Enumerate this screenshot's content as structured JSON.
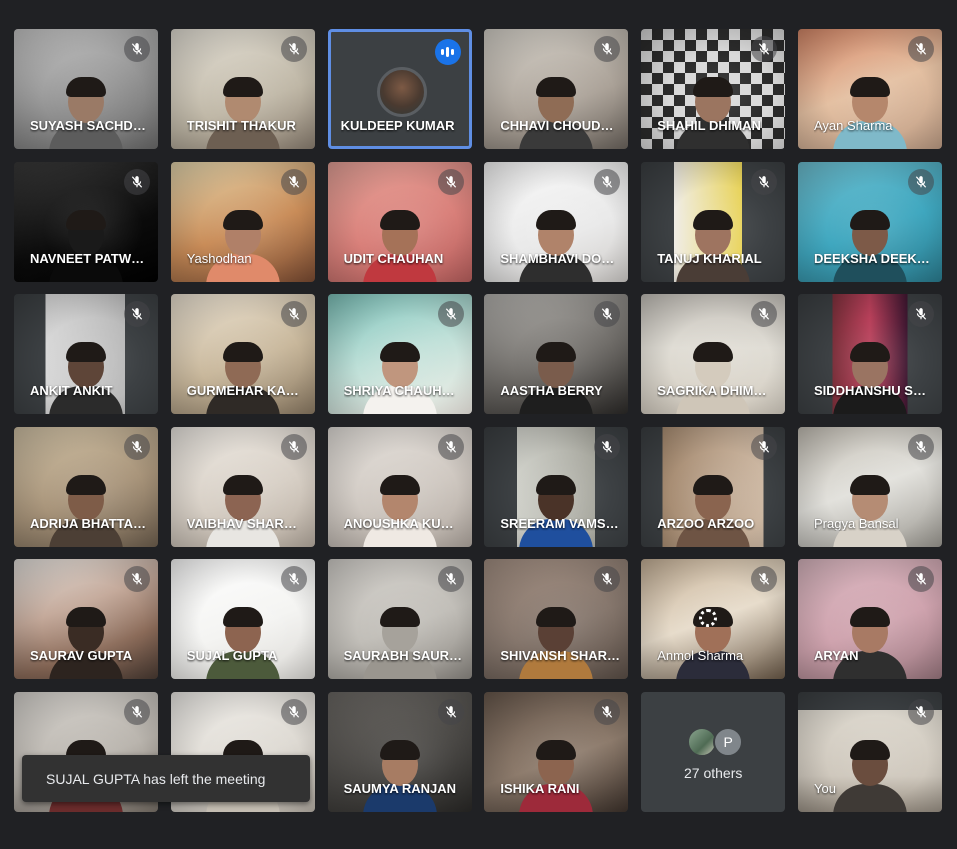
{
  "tiles": [
    {
      "name": "SUYASH SACHD…",
      "bg": "linear-gradient(160deg,#c9c9c9,#8d8d8d 60%,#6b6b6b)",
      "skin": "#9a7a66",
      "shirt": "#5c5c5c",
      "muted": true
    },
    {
      "name": "TRISHIT THAKUR",
      "bg": "linear-gradient(160deg,#e6e2d8,#bfb7a6 60%,#8c8072)",
      "skin": "#b08a70",
      "shirt": "#6d5f52",
      "muted": true
    },
    {
      "name": "KULDEEP KUMAR",
      "speaking": true
    },
    {
      "name": "CHHAVI CHOUD…",
      "bg": "linear-gradient(160deg,#d8d4cc,#aaa197 60%,#6c655e)",
      "skin": "#8f6c55",
      "shirt": "#3a3a3a",
      "muted": true
    },
    {
      "name": "SHAHIL DHIMAN",
      "bg": "repeating-conic-gradient(#2b2b2b 0% 25%,#d9d9d9 0% 50%) 0 0/22px 22px",
      "skin": "#9b7560",
      "shirt": "#2f2f2f",
      "muted": true
    },
    {
      "name": "Ayan Sharma",
      "bg": "linear-gradient(160deg,#d98a6a,#e4c0a2 50%,#bf9e86)",
      "skin": "#b5876c",
      "shirt": "#7fb9c9",
      "muted": true,
      "mixed": true
    },
    {
      "name": "NAVNEET PATW…",
      "bg": "linear-gradient(160deg,#3a3a3a,#0b0b0b 60%,#000)",
      "skin": "#1a1a1a",
      "shirt": "#0a0a0a",
      "muted": true
    },
    {
      "name": "Yashodhan",
      "bg": "linear-gradient(160deg,#e8d9b0,#c98c58 55%,#7a4b32)",
      "skin": "#b08068",
      "shirt": "#e08a6a",
      "muted": true,
      "mixed": true
    },
    {
      "name": "UDIT CHAUHAN",
      "bg": "linear-gradient(160deg,#e8a49a,#d9807a 55%,#b9605e)",
      "skin": "#a57258",
      "shirt": "#c0393f",
      "muted": true
    },
    {
      "name": "SHAMBHAVI DO…",
      "bg": "linear-gradient(160deg,#fafafa,#e9e9e9 60%,#d0cdca)",
      "skin": "#b0836a",
      "shirt": "#2e2e2e",
      "muted": true
    },
    {
      "name": "TANUJ KHARIAL",
      "bg": "linear-gradient(90deg,#3c4043 0%,#3c4043 23%,#f0ede6 23%,#e8d35a 70%,#3c4043 70%)",
      "skin": "#9e7460",
      "shirt": "#4a3d36",
      "muted": true
    },
    {
      "name": "DEEKSHA DEEK…",
      "bg": "linear-gradient(160deg,#6fc1d3,#3fa7bf 55%,#2b7d90)",
      "skin": "#7d5a48",
      "shirt": "#1f4f5c",
      "muted": true
    },
    {
      "name": "ANKIT ANKIT",
      "bg": "linear-gradient(90deg,#3c4043 0%,#3c4043 22%,#d8d8d8 22%,#b9b9b9 77%,#3c4043 77%)",
      "skin": "#5e4538",
      "shirt": "#2b2b2b",
      "muted": true
    },
    {
      "name": "GURMEHAR KA…",
      "bg": "linear-gradient(160deg,#efe6d6,#c8b79b 55%,#8c7b64)",
      "skin": "#8f6a55",
      "shirt": "#2f2a26",
      "muted": true
    },
    {
      "name": "SHRIYA CHAUH…",
      "bg": "linear-gradient(160deg,#7fc5bd,#bfe0d8 50%,#f3efe8)",
      "skin": "#c0967e",
      "shirt": "#f4f2ee",
      "muted": true
    },
    {
      "name": "AASTHA BERRY",
      "bg": "linear-gradient(160deg,#b8b6b2,#6f6c68 55%,#2c2a28)",
      "skin": "#7a5c4c",
      "shirt": "#1e1e1e",
      "muted": true
    },
    {
      "name": "SAGRIKA DHIM…",
      "bg": "linear-gradient(180deg,#c9c5be,#e0ddd5 45%,#d6cfc3)",
      "skin": "#d4cbbd",
      "shirt": "#cfc6b8",
      "muted": true
    },
    {
      "name": "SIDDHANSHU S…",
      "bg": "linear-gradient(90deg,#3c4043 0%,#3c4043 24%,#7a2f3a 24%,#b8405a 50%,#3d1630 76%,#3c4043 76%)",
      "skin": "#9a7462",
      "shirt": "#1b1b1b",
      "muted": true
    },
    {
      "name": "ADRIJA BHATTA…",
      "bg": "linear-gradient(160deg,#d3c4a8,#a8947a 55%,#6f604f)",
      "skin": "#7e5c48",
      "shirt": "#4c3f35",
      "muted": true
    },
    {
      "name": "VAIBHAV SHAR…",
      "bg": "linear-gradient(160deg,#f0ece6,#d7cfc5 55%,#b8ada1)",
      "skin": "#8c6452",
      "shirt": "#e8e6e2",
      "muted": true
    },
    {
      "name": "ANOUSHKA KU…",
      "bg": "linear-gradient(160deg,#e8e4df,#cfc8c1 55%,#b3aaa2)",
      "skin": "#b3866d",
      "shirt": "#efe9e3",
      "muted": true
    },
    {
      "name": "SREERAM VAMS…",
      "bg": "linear-gradient(90deg,#3c4043 0%,#3c4043 23%,#cfd0c9 23%,#a7a79e 77%,#3c4043 77%)",
      "skin": "#4a3328",
      "shirt": "#1f4f9e",
      "muted": true
    },
    {
      "name": "ARZOO ARZOO",
      "bg": "linear-gradient(90deg,#3c4043 0%,#3c4043 15%,#a58a70 15%,#cdb8a3 85%,#3c4043 85%)",
      "skin": "#8a644f",
      "shirt": "#6e5444",
      "muted": true
    },
    {
      "name": "Pragya Bansal",
      "bg": "linear-gradient(160deg,#c7c2b8,#e2e1dc 50%,#9d9a93)",
      "skin": "#b58c74",
      "shirt": "#d8d2c8",
      "muted": true,
      "mixed": true
    },
    {
      "name": "SAURAV GUPTA",
      "bg": "linear-gradient(160deg,#e8e5e1,#c4a99a 40%,#8a6a58 70%,#4a3b33)",
      "skin": "#3a2c24",
      "shirt": "#2d241f",
      "muted": true
    },
    {
      "name": "SUJAL GUPTA",
      "bg": "linear-gradient(160deg,#ffffff,#f4f4f2 55%,#dcdad6)",
      "skin": "#8d6450",
      "shirt": "#4c5a3b",
      "muted": true
    },
    {
      "name": "SAURABH SAUR…",
      "bg": "linear-gradient(160deg,#d6d3ce,#c1beb8 55%,#8e8a84)",
      "skin": "#a6a29b",
      "shirt": "#9a968f",
      "muted": true
    },
    {
      "name": "SHIVANSH SHAR…",
      "bg": "linear-gradient(160deg,#a59184,#85766c 55%,#5b4f47)",
      "skin": "#5a4035",
      "shirt": "#b07a3d",
      "muted": true
    },
    {
      "name": "Anmol Sharma",
      "bg": "linear-gradient(160deg,#c9b49a,#e7dccb 50%,#6b5a48)",
      "skin": "#a07058",
      "shirt": "#2b2c3a",
      "muted": true,
      "mixed": true,
      "loading": true
    },
    {
      "name": "ARYAN",
      "bg": "linear-gradient(160deg,#dcb9c2,#cfa3ae 55%,#9b7880)",
      "skin": "#a87a64",
      "shirt": "#2f2f2f",
      "muted": true
    },
    {
      "name": "",
      "bg": "linear-gradient(160deg,#d9d6d1,#b9b4ad 55%,#7c746b)",
      "skin": "#8a5f4b",
      "shirt": "#6b2c2c",
      "muted": true,
      "hidden_label": true
    },
    {
      "name": "",
      "bg": "linear-gradient(160deg,#f2f0ec,#dedad3 55%,#bbb4aa)",
      "skin": "#cfc9c0",
      "shirt": "#c4bdb2",
      "muted": true,
      "hidden_label": true
    },
    {
      "name": "SAUMYA RANJAN",
      "bg": "linear-gradient(160deg,#6d6a66,#4a4845 55%,#2a2927)",
      "skin": "#a77c63",
      "shirt": "#1b3a6b",
      "muted": true
    },
    {
      "name": "ISHIKA RANI",
      "bg": "linear-gradient(160deg,#6a5a4e,#8d7b6c 55%,#3e332c)",
      "skin": "#8c644f",
      "shirt": "#9d2a3a",
      "muted": true
    },
    {
      "name": "27 others",
      "others": true,
      "letter": "P"
    },
    {
      "name": "You",
      "bg": "linear-gradient(180deg,#3c4043 0%,#3c4043 15%,#dcd7cd 15%,#cfc8bd 70%,#9b9286 100%)",
      "skin": "#6a4d3e",
      "shirt": "#3f3a36",
      "muted": true,
      "mixed": true
    }
  ],
  "toast": {
    "text": "SUJAL GUPTA has left the meeting"
  }
}
